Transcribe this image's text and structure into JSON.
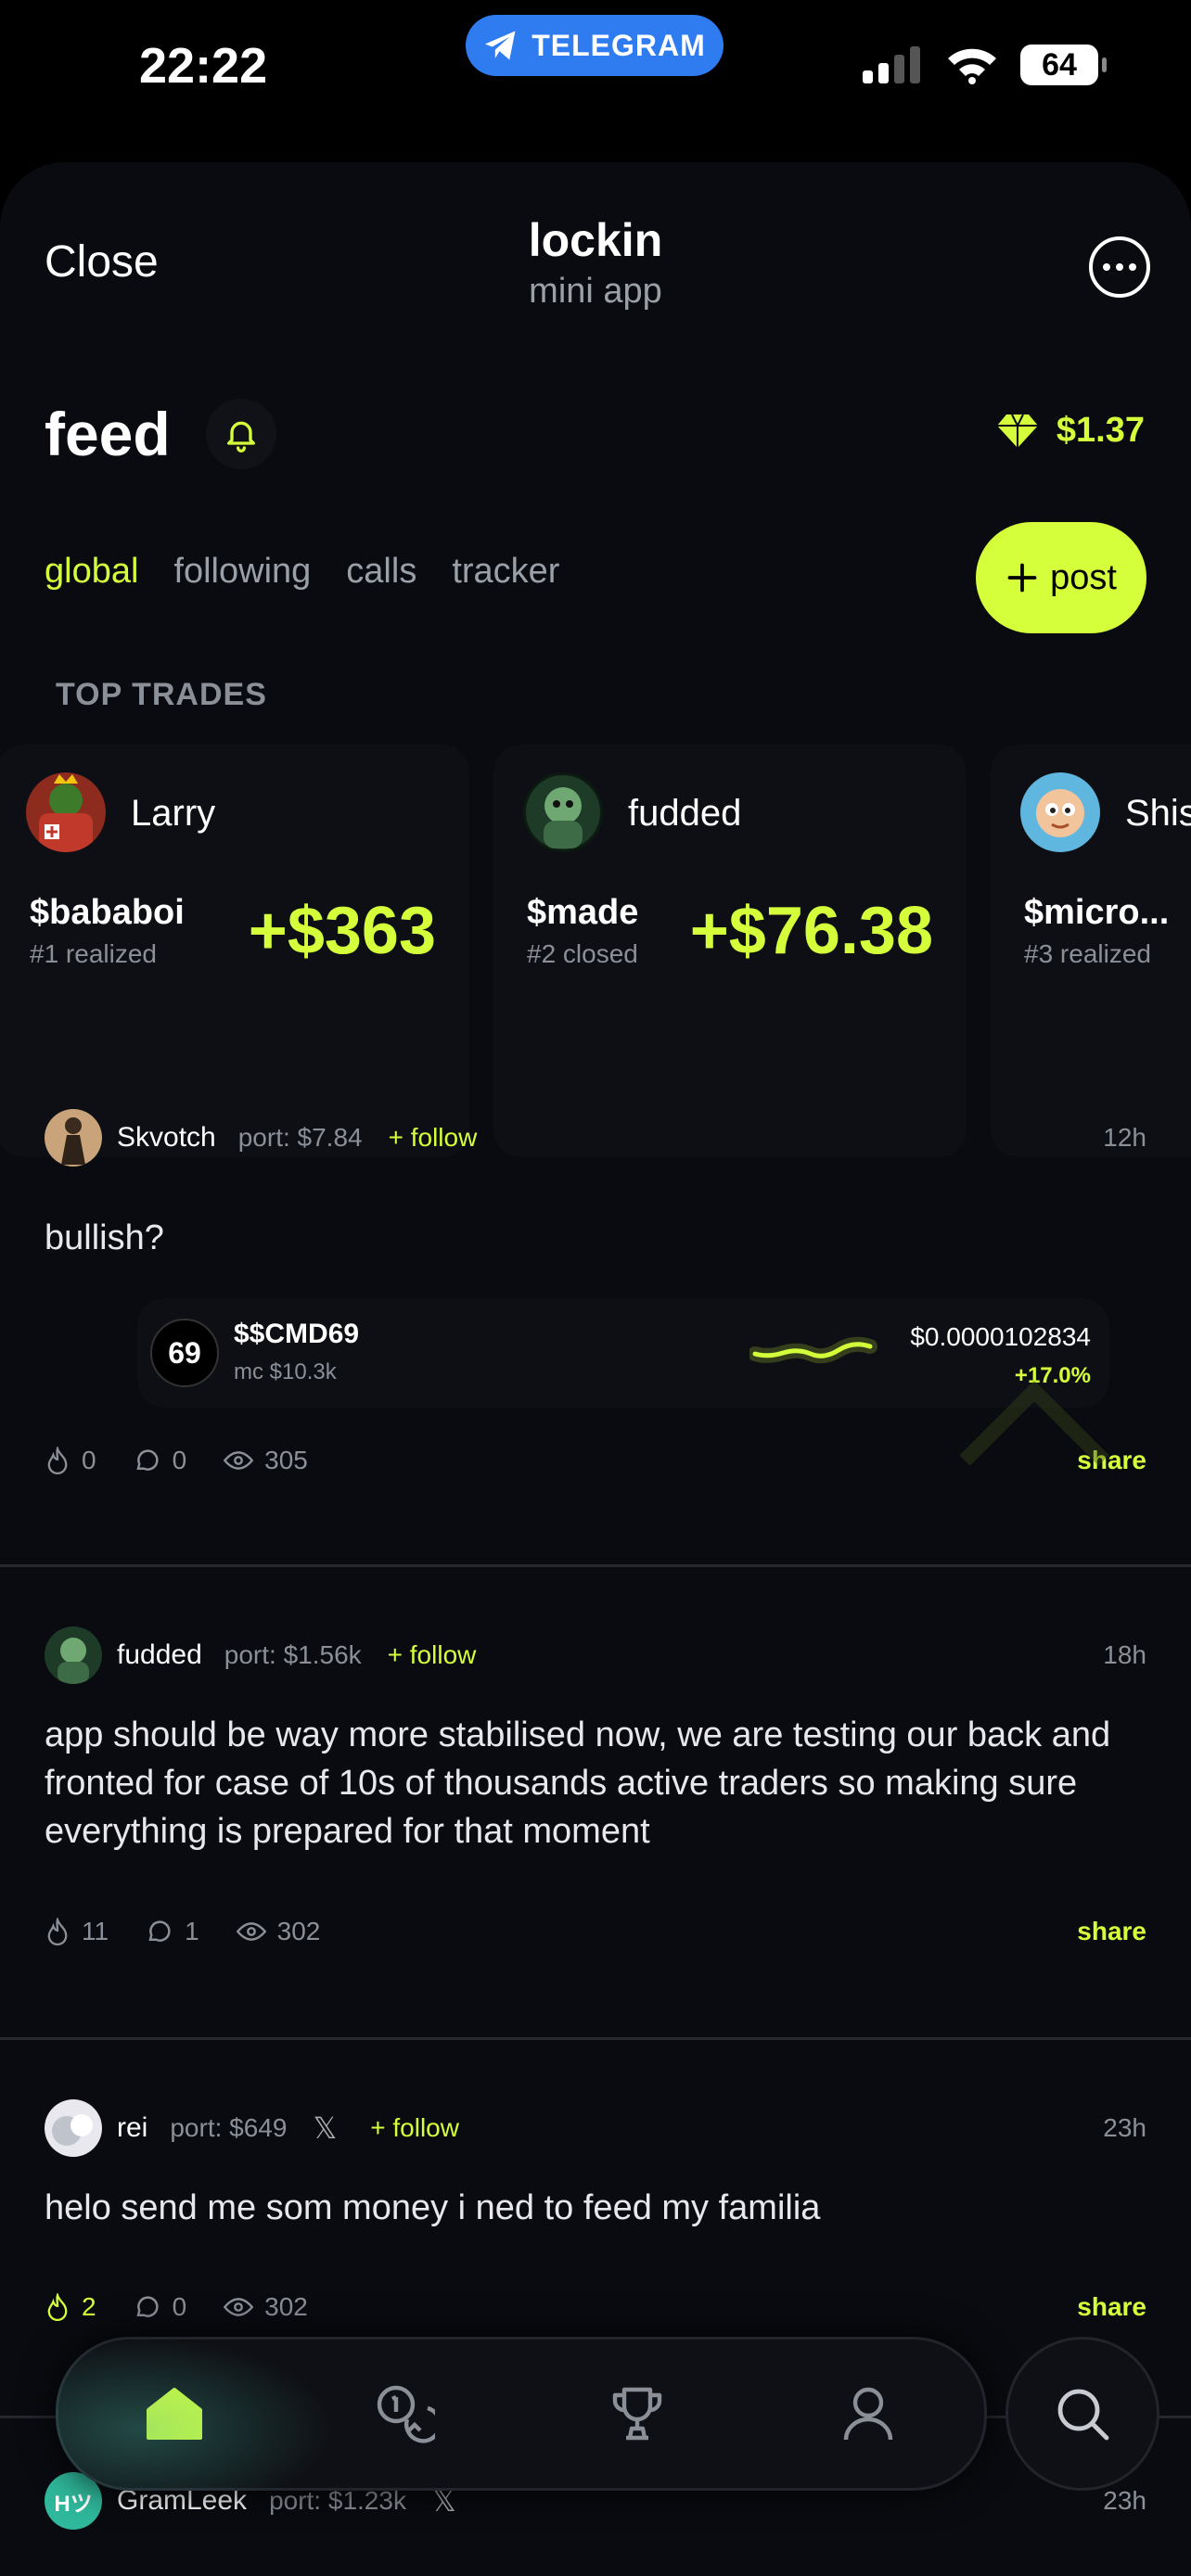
{
  "status_bar": {
    "time": "22:22",
    "app_pill": "TELEGRAM",
    "battery": "64"
  },
  "header": {
    "close_label": "Close",
    "title": "lockin",
    "subtitle": "mini app"
  },
  "feed": {
    "title": "feed",
    "balance": "$1.37",
    "tabs": [
      "global",
      "following",
      "calls",
      "tracker"
    ],
    "active_tab": "global",
    "post_button": "post",
    "accent_color": "#d4ff3a"
  },
  "top_trades": {
    "label": "TOP TRADES",
    "cards": [
      {
        "user": "Larry",
        "ticker": "$bababoi",
        "rank": "#1 realized",
        "pnl": "+$363"
      },
      {
        "user": "fudded",
        "ticker": "$made",
        "rank": "#2 closed",
        "pnl": "+$76.38"
      },
      {
        "user": "Shis",
        "ticker": "$micro...",
        "rank": "#3 realized",
        "pnl": ""
      }
    ]
  },
  "posts": [
    {
      "user": "Skvotch",
      "port": "port: $7.84",
      "follow": "follow",
      "time": "12h",
      "x_icon": "",
      "text": "bullish?",
      "token": {
        "logo": "69",
        "name": "$$CMD69",
        "mc": "mc $10.3k",
        "price": "$0.0000102834",
        "change": "+17.0%"
      },
      "stats": {
        "likes": "0",
        "comments": "0",
        "views": "305"
      },
      "share": "share"
    },
    {
      "user": "fudded",
      "port": "port: $1.56k",
      "follow": "follow",
      "time": "18h",
      "x_icon": "",
      "text": "app should be way more stabilised now, we are testing our back and fronted for case of 10s of thousands active traders so making sure everything is prepared for that moment",
      "stats": {
        "likes": "11",
        "comments": "1",
        "views": "302"
      },
      "share": "share"
    },
    {
      "user": "rei",
      "port": "port: $649",
      "follow": "follow",
      "time": "23h",
      "x_icon": "𝕏",
      "text": "helo send me som money i ned to feed my familia",
      "stats": {
        "likes": "2",
        "comments": "0",
        "views": "302"
      },
      "share": "share"
    },
    {
      "user": "GramLeek",
      "port": "port: $1.23k",
      "time": "23h",
      "x_icon": "𝕏",
      "avatar_text": "Hツ"
    }
  ],
  "nav": {
    "items": [
      "home-icon",
      "coins-icon",
      "trophy-icon",
      "profile-icon"
    ],
    "search": "search-icon"
  }
}
